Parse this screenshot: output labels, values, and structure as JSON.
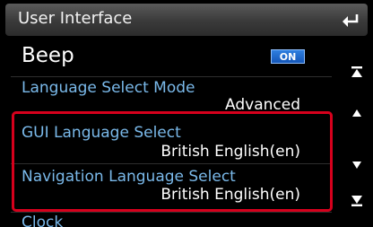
{
  "header": {
    "title": "User Interface",
    "back_icon": "back-arrow-icon"
  },
  "items": [
    {
      "label": "Beep",
      "toggle": "ON"
    },
    {
      "label": "Language Select Mode",
      "value": "Advanced"
    },
    {
      "label": "GUI Language Select",
      "value": "British English(en)"
    },
    {
      "label": "Navigation Language Select",
      "value": "British English(en)"
    },
    {
      "label": "Clock"
    }
  ],
  "scroll": {
    "icons": [
      "scroll-top-icon",
      "scroll-up-icon",
      "scroll-down-icon",
      "scroll-bottom-icon"
    ]
  },
  "colors": {
    "accent_label": "#7ab9ea",
    "highlight": "#d6001c",
    "toggle_on": "#1f6cd0"
  }
}
